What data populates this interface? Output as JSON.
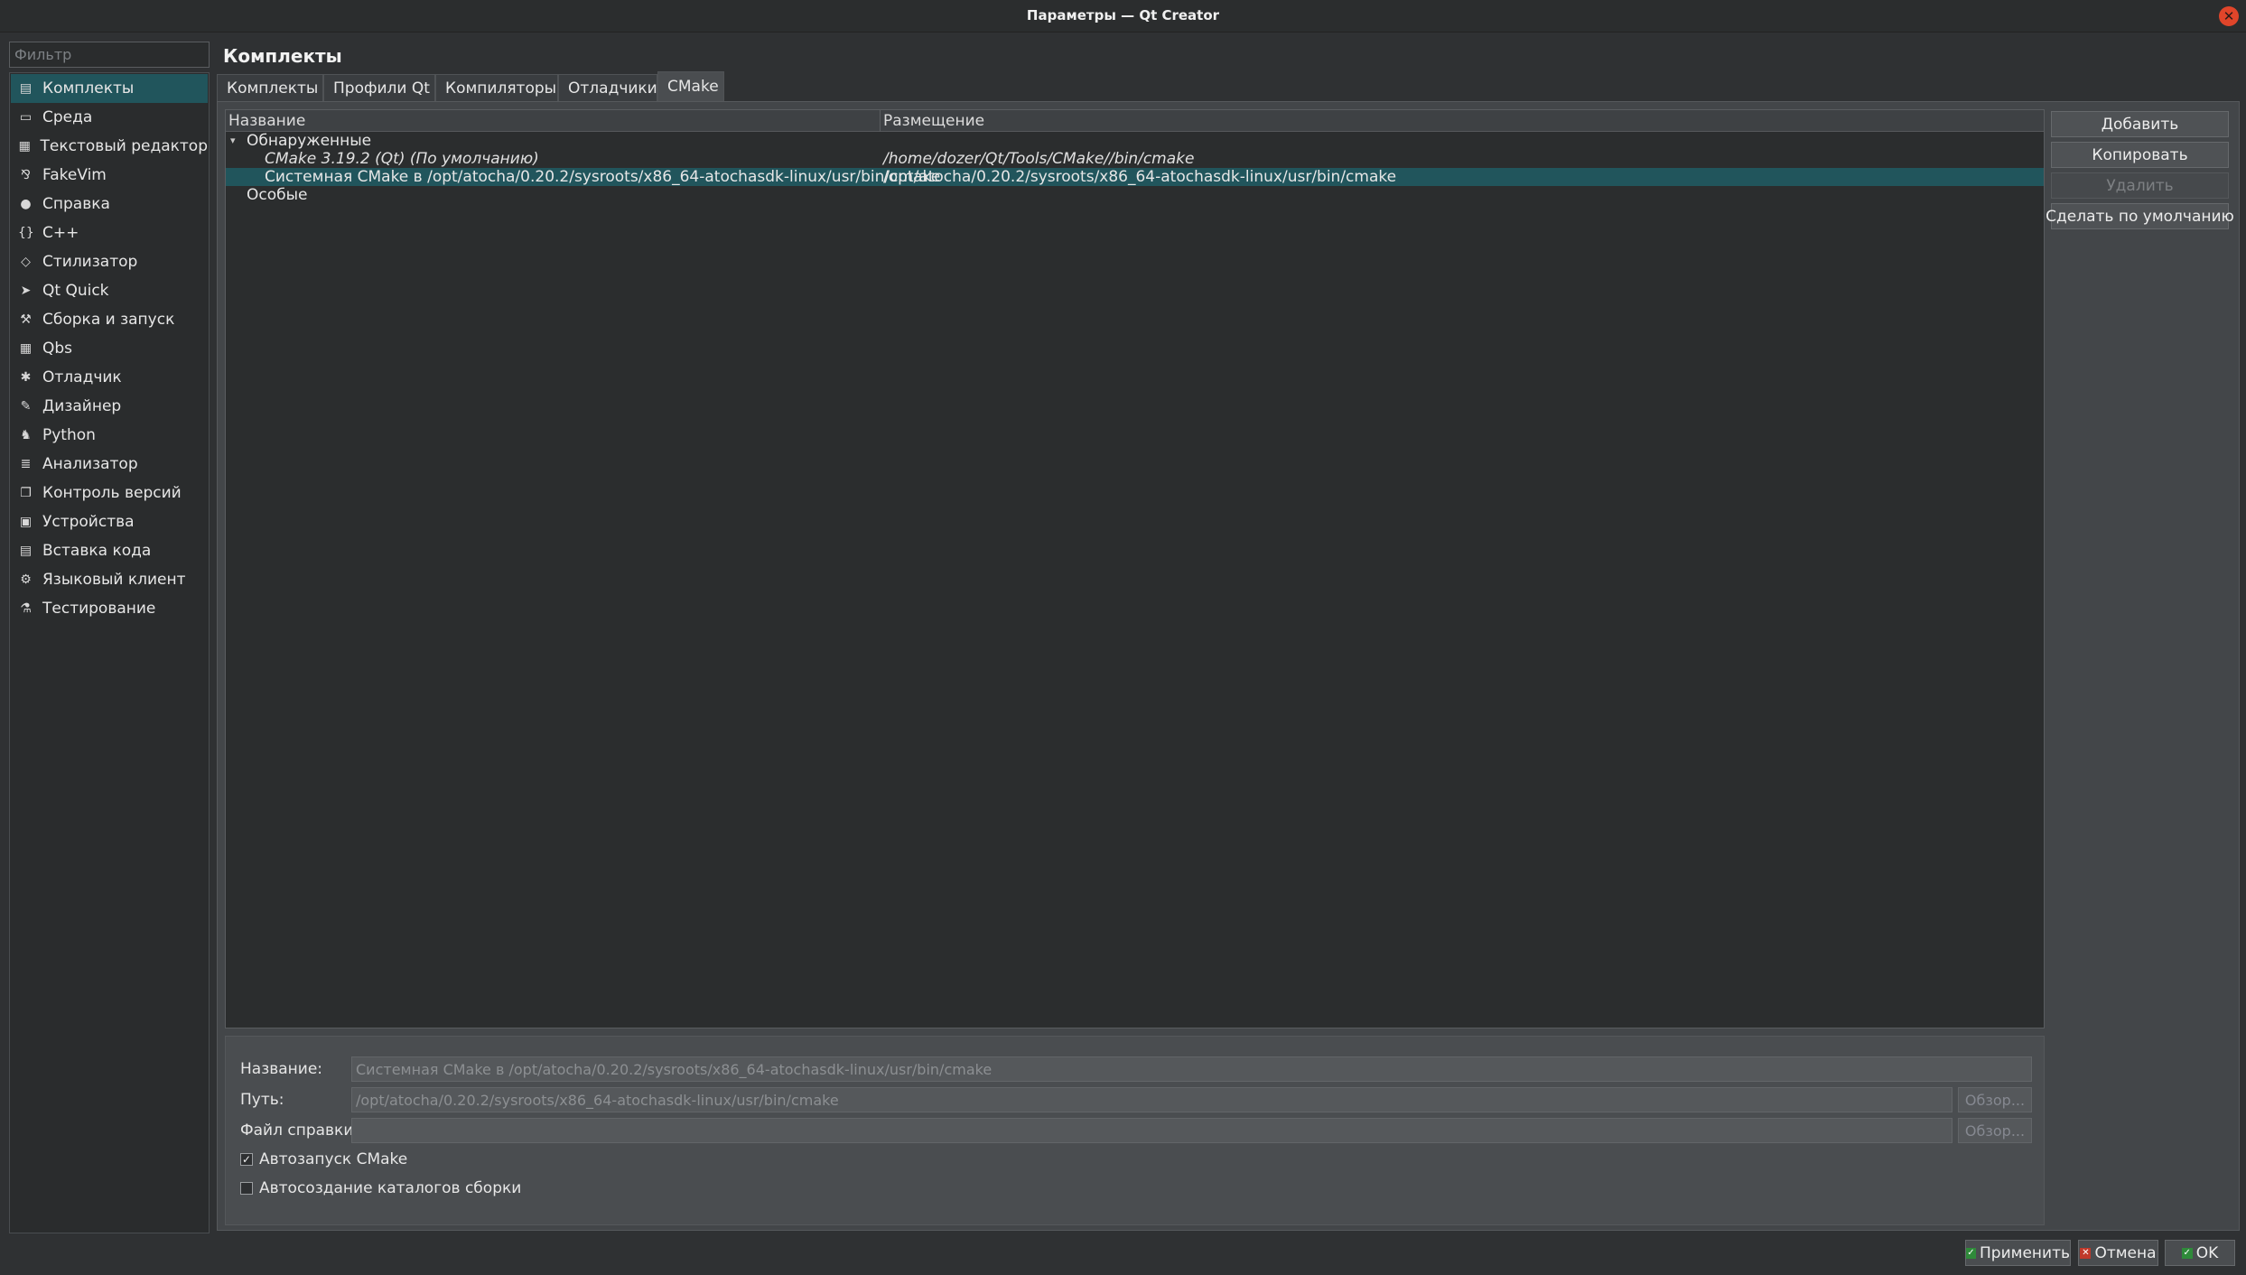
{
  "window": {
    "title": "Параметры — Qt Creator",
    "close_icon": "close-icon"
  },
  "sidebar": {
    "filter_placeholder": "Фильтр",
    "selected": "Комплекты",
    "items": [
      {
        "label": "Комплекты",
        "icon": "kits-icon",
        "glyph": "▤"
      },
      {
        "label": "Среда",
        "icon": "monitor-icon",
        "glyph": "▭"
      },
      {
        "label": "Текстовый редактор",
        "icon": "text-editor-icon",
        "glyph": "▦"
      },
      {
        "label": "FakeVim",
        "icon": "fakevim-icon",
        "glyph": "⅋"
      },
      {
        "label": "Справка",
        "icon": "help-icon",
        "glyph": "●"
      },
      {
        "label": "C++",
        "icon": "cpp-braces-icon",
        "glyph": "{}"
      },
      {
        "label": "Стилизатор",
        "icon": "beautifier-gem-icon",
        "glyph": "◇"
      },
      {
        "label": "Qt Quick",
        "icon": "qt-quick-arrow-icon",
        "glyph": "➤"
      },
      {
        "label": "Сборка и запуск",
        "icon": "hammer-icon",
        "glyph": "⚒"
      },
      {
        "label": "Qbs",
        "icon": "qbs-icon",
        "glyph": "▦"
      },
      {
        "label": "Отладчик",
        "icon": "bug-icon",
        "glyph": "✱"
      },
      {
        "label": "Дизайнер",
        "icon": "pen-icon",
        "glyph": "✎"
      },
      {
        "label": "Python",
        "icon": "python-icon",
        "glyph": "♞"
      },
      {
        "label": "Анализатор",
        "icon": "analyzer-icon",
        "glyph": "≣"
      },
      {
        "label": "Контроль версий",
        "icon": "version-control-icon",
        "glyph": "❐"
      },
      {
        "label": "Устройства",
        "icon": "devices-icon",
        "glyph": "▣"
      },
      {
        "label": "Вставка кода",
        "icon": "code-paste-icon",
        "glyph": "▤"
      },
      {
        "label": "Языковый клиент",
        "icon": "language-client-icon",
        "glyph": "⚙"
      },
      {
        "label": "Тестирование",
        "icon": "testing-flask-icon",
        "glyph": "⚗"
      }
    ]
  },
  "page": {
    "title": "Комплекты"
  },
  "tabs": [
    {
      "label": "Комплекты"
    },
    {
      "label": "Профили Qt"
    },
    {
      "label": "Компиляторы"
    },
    {
      "label": "Отладчики"
    },
    {
      "label": "CMake"
    }
  ],
  "active_tab": "CMake",
  "tree": {
    "columns": [
      "Название",
      "Размещение"
    ],
    "groups": [
      {
        "label": "Обнаруженные",
        "expanded": true,
        "rows": [
          {
            "name": "CMake 3.19.2 (Qt) (По умолчанию)",
            "location": "/home/dozer/Qt/Tools/CMake//bin/cmake",
            "italic": true,
            "selected": false
          },
          {
            "name": "Системная CMake в /opt/atocha/0.20.2/sysroots/x86_64-atochasdk-linux/usr/bin/cmake",
            "location": "/opt/atocha/0.20.2/sysroots/x86_64-atochasdk-linux/usr/bin/cmake",
            "italic": false,
            "selected": true
          }
        ]
      },
      {
        "label": "Особые",
        "expanded": false,
        "rows": []
      }
    ]
  },
  "side_buttons": {
    "add": "Добавить",
    "copy": "Копировать",
    "remove": "Удалить",
    "make_default": "Сделать по умолчанию"
  },
  "details": {
    "name_label": "Название:",
    "name_value": "Системная CMake в /opt/atocha/0.20.2/sysroots/x86_64-atochasdk-linux/usr/bin/cmake",
    "path_label": "Путь:",
    "path_value": "/opt/atocha/0.20.2/sysroots/x86_64-atochasdk-linux/usr/bin/cmake",
    "help_label": "Файл справки:",
    "help_value": "",
    "browse": "Обзор...",
    "autorun_label": "Автозапуск CMake",
    "autorun_checked": true,
    "autocreate_label": "Автосоздание каталогов сборки",
    "autocreate_checked": false
  },
  "dialog_buttons": {
    "apply": "Применить",
    "cancel": "Отмена",
    "ok": "OK"
  },
  "colors": {
    "selection": "#21555c",
    "background": "#2f3133",
    "close": "#e0452a"
  }
}
